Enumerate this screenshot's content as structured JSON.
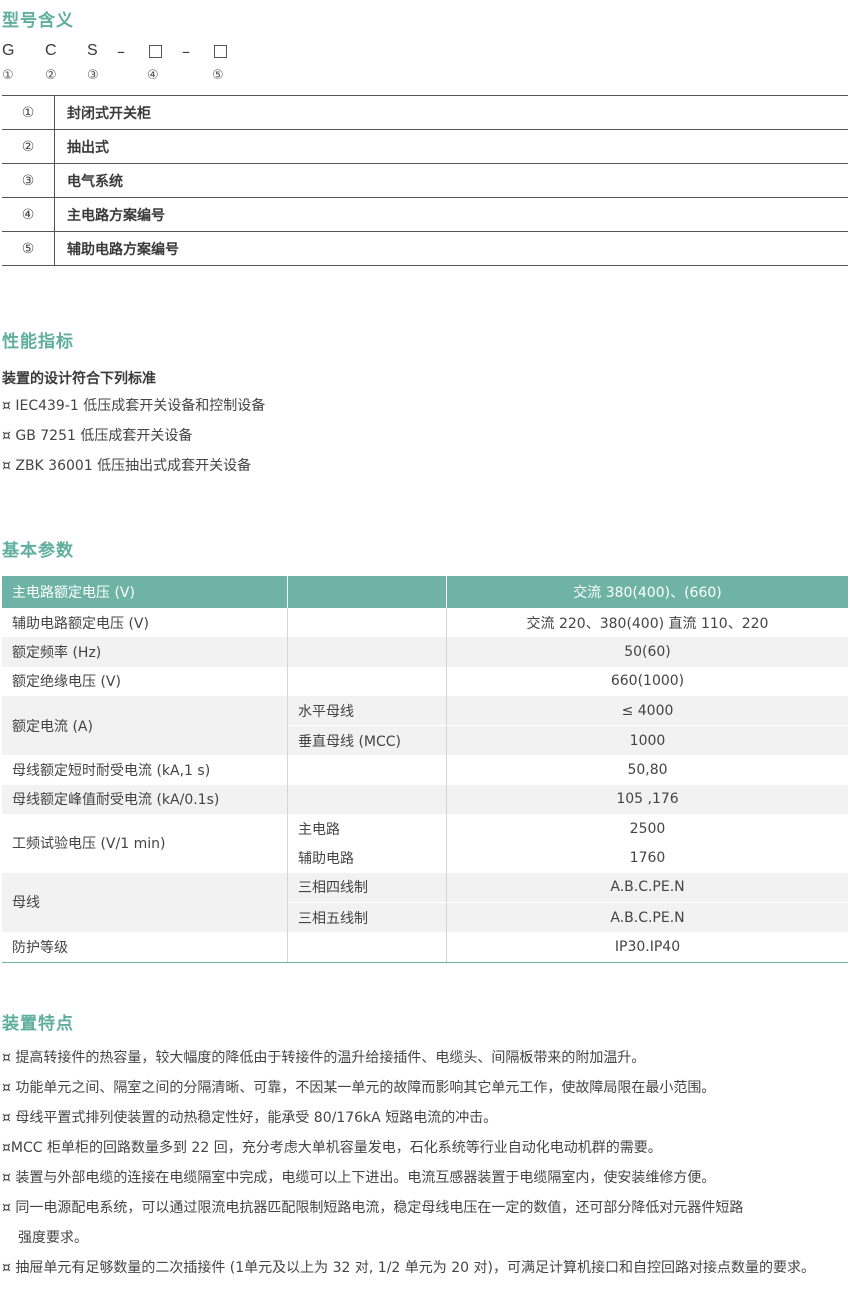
{
  "sections": {
    "model_meaning": "型号含义",
    "performance": "性能指标",
    "basic_params": "基本参数",
    "features": "装置特点"
  },
  "model_code": {
    "chars": [
      "G",
      "C",
      "S"
    ],
    "separator": "–",
    "numbers": [
      "①",
      "②",
      "③",
      "④",
      "⑤"
    ]
  },
  "meaning_rows": [
    {
      "num": "①",
      "text": "封闭式开关柜"
    },
    {
      "num": "②",
      "text": "抽出式"
    },
    {
      "num": "③",
      "text": "电气系统"
    },
    {
      "num": "④",
      "text": "主电路方案编号"
    },
    {
      "num": "⑤",
      "text": "辅助电路方案编号"
    }
  ],
  "performance": {
    "subtitle": "装置的设计符合下列标准",
    "standards": [
      "¤ IEC439-1 低压成套开关设备和控制设备",
      "¤ GB 7251  低压成套开关设备",
      "¤ ZBK 36001 低压抽出式成套开关设备"
    ]
  },
  "params": {
    "header": {
      "label": "主电路额定电压 (V)",
      "sub": "",
      "value": "交流 380(400)、(660)"
    },
    "rows": [
      {
        "label": "辅助电路额定电压 (V)",
        "value": "交流 220、380(400)  直流 110、220"
      },
      {
        "label": "额定频率 (Hz)",
        "value": "50(60)"
      },
      {
        "label": "额定绝缘电压 (V)",
        "value": "660(1000)"
      },
      {
        "label": "额定电流 (A)",
        "subs": [
          {
            "sub": "水平母线",
            "value": "≤ 4000"
          },
          {
            "sub": "垂直母线 (MCC)",
            "value": "1000"
          }
        ]
      },
      {
        "label": "母线额定短时耐受电流 (kA,1 s)",
        "value": "50,80"
      },
      {
        "label": "母线额定峰值耐受电流 (kA/0.1s)",
        "value": "105 ,176"
      },
      {
        "label": "工频试验电压 (V/1 min)",
        "subs": [
          {
            "sub": "主电路",
            "value": "2500"
          },
          {
            "sub": "辅助电路",
            "value": "1760"
          }
        ]
      },
      {
        "label": "母线",
        "subs": [
          {
            "sub": "三相四线制",
            "value": "A.B.C.PE.N"
          },
          {
            "sub": "三相五线制",
            "value": "A.B.C.PE.N"
          }
        ]
      },
      {
        "label": "防护等级",
        "value": "IP30.IP40"
      }
    ]
  },
  "features": {
    "items": [
      "¤ 提高转接件的热容量，较大幅度的降低由于转接件的温升给接插件、电缆头、间隔板带来的附加温升。",
      "¤ 功能单元之间、隔室之间的分隔清晰、可靠，不因某一单元的故障而影响其它单元工作，使故障局限在最小范围。",
      "¤ 母线平置式排列使装置的动热稳定性好，能承受 80/176kA 短路电流的冲击。",
      "¤MCC 柜单柜的回路数量多到 22 回，充分考虑大单机容量发电，石化系统等行业自动化电动机群的需要。",
      "¤ 装置与外部电缆的连接在电缆隔室中完成，电缆可以上下进出。电流互感器装置于电缆隔室内，使安装维修方便。"
    ],
    "item6_line1": "¤ 同一电源配电系统，可以通过限流电抗器匹配限制短路电流，稳定母线电压在一定的数值，还可部分降低对元器件短路",
    "item6_line2": "强度要求。",
    "item7": "¤ 抽屉单元有足够数量的二次插接件 (1单元及以上为 32 对, 1/2 单元为 20 对)，可满足计算机接口和自控回路对接点数量的要求。"
  }
}
